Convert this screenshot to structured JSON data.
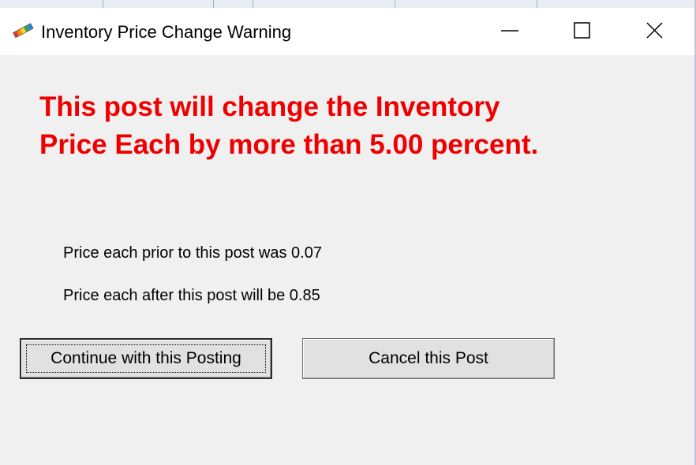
{
  "window": {
    "title": "Inventory Price Change Warning",
    "icons": {
      "app": "rainbow-app-icon",
      "minimize": "minimize-icon",
      "maximize": "maximize-icon",
      "close": "close-icon"
    }
  },
  "message": {
    "warning": "This post will change the Inventory Price Each by more than 5.00 percent.",
    "warning_color": "#ee0000",
    "prior": "Price each prior to this post was 0.07",
    "after": "Price each after this post will be 0.85"
  },
  "buttons": {
    "continue_label": "Continue with this Posting",
    "cancel_label": "Cancel this Post"
  }
}
